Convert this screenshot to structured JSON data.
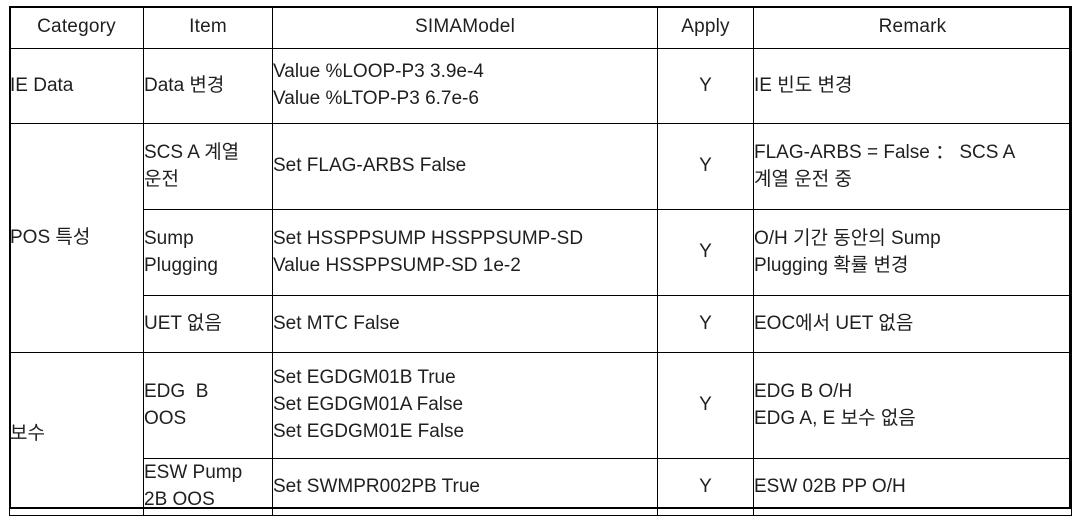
{
  "table": {
    "headers": [
      "Category",
      "Item",
      "SIMAModel",
      "Apply",
      "Remark"
    ],
    "rows": [
      {
        "category": "IE Data",
        "category_rowspan": 1,
        "item": "Data 변경",
        "item_lines": [
          "Data 변경"
        ],
        "model_lines": [
          "Value %LOOP-P3 3.9e-4",
          "Value %LTOP-P3 6.7e-6"
        ],
        "apply": "Y",
        "remark_lines": [
          "IE 빈도 변경"
        ]
      },
      {
        "category": "POS 특성",
        "category_rowspan": 3,
        "item": "SCS A 계열 운전",
        "item_lines": [
          "SCS A 계열",
          "운전"
        ],
        "model_lines": [
          "Set FLAG-ARBS False"
        ],
        "apply": "Y",
        "remark_lines": [
          "FLAG-ARBS = False ： SCS A",
          "계열 운전 중"
        ]
      },
      {
        "item": "Sump Plugging",
        "item_lines": [
          "Sump",
          "Plugging"
        ],
        "model_lines": [
          "Set HSSPPSUMP HSSPPSUMP-SD",
          "Value HSSPPSUMP-SD 1e-2"
        ],
        "apply": "Y",
        "remark_lines": [
          "O/H 기간 동안의 Sump",
          "Plugging 확률 변경"
        ]
      },
      {
        "item": "UET 없음",
        "item_lines": [
          "UET 없음"
        ],
        "model_lines": [
          "Set MTC False"
        ],
        "apply": "Y",
        "remark_lines": [
          "EOC에서 UET 없음"
        ]
      },
      {
        "category": "보수",
        "category_rowspan": 2,
        "item": "EDG  B OOS",
        "item_lines": [
          "EDG  B",
          "OOS"
        ],
        "model_lines": [
          "Set EGDGM01B True",
          "Set EGDGM01A False",
          "Set EGDGM01E False"
        ],
        "apply": "Y",
        "remark_lines": [
          "EDG B O/H",
          "EDG A, E 보수 없음"
        ]
      },
      {
        "item": "ESW Pump 2B OOS",
        "item_lines": [
          "ESW Pump",
          "2B OOS"
        ],
        "model_lines": [
          "Set SWMPR002PB True"
        ],
        "apply": "Y",
        "remark_lines": [
          "ESW 02B PP O/H"
        ]
      }
    ]
  },
  "colors": {
    "border": "#000000",
    "text": "#1f1f1f",
    "background": "#ffffff"
  }
}
